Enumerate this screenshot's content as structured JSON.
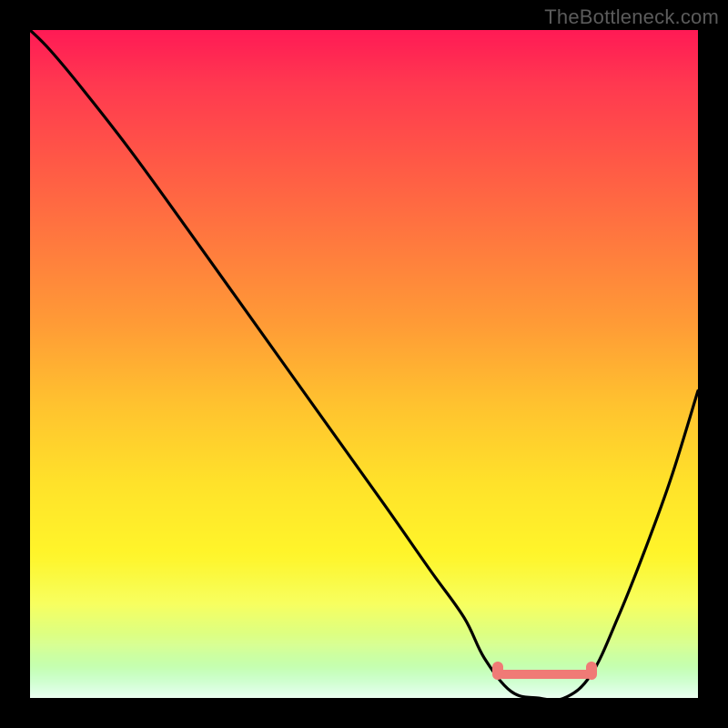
{
  "attribution": "TheBottleneck.com",
  "colors": {
    "background": "#000000",
    "curve": "#000000",
    "marker": "#f07a76",
    "gradient_stops": [
      {
        "pos": 0.0,
        "hex": "#ff1a55"
      },
      {
        "pos": 0.08,
        "hex": "#ff3850"
      },
      {
        "pos": 0.2,
        "hex": "#ff5946"
      },
      {
        "pos": 0.32,
        "hex": "#ff7a3e"
      },
      {
        "pos": 0.44,
        "hex": "#ff9b36"
      },
      {
        "pos": 0.56,
        "hex": "#ffc22f"
      },
      {
        "pos": 0.68,
        "hex": "#ffe22a"
      },
      {
        "pos": 0.78,
        "hex": "#fff42a"
      },
      {
        "pos": 0.86,
        "hex": "#f6ff4a"
      },
      {
        "pos": 0.92,
        "hex": "#c8ff66"
      },
      {
        "pos": 1.0,
        "hex": "#4dff78"
      }
    ]
  },
  "chart_data": {
    "type": "line",
    "title": "",
    "xlabel": "",
    "ylabel": "",
    "xlim": [
      0,
      100
    ],
    "ylim": [
      0,
      100
    ],
    "series": [
      {
        "name": "bottleneck-curve",
        "x": [
          0,
          3,
          8,
          15,
          23,
          33,
          43,
          53,
          60,
          65,
          68,
          72,
          76,
          80,
          84,
          88,
          92,
          96,
          100
        ],
        "y": [
          100,
          97,
          91,
          82,
          71,
          57,
          43,
          29,
          19,
          12,
          6,
          1,
          0,
          0,
          3.5,
          12,
          22,
          33,
          46
        ]
      }
    ],
    "marker_range_x": [
      70,
      84
    ],
    "marker_y": 3.5
  }
}
